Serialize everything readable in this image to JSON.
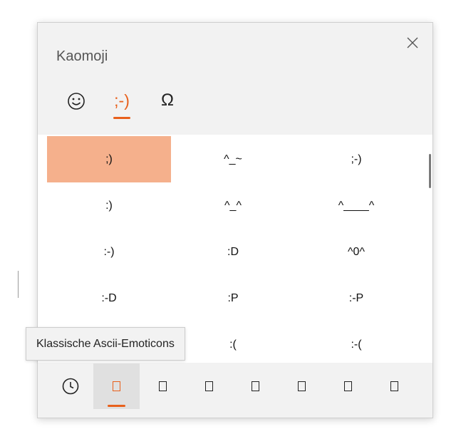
{
  "panel": {
    "title": "Kaomoji",
    "close_icon": "close-icon"
  },
  "category_tabs": [
    {
      "name": "emoji",
      "glyph": "☺",
      "icon": "smiley-icon",
      "active": false
    },
    {
      "name": "kaomoji",
      "glyph": ";-)",
      "icon": "kaomoji-icon",
      "active": true
    },
    {
      "name": "symbols",
      "glyph": "Ω",
      "icon": "omega-icon",
      "active": false
    }
  ],
  "kaomoji_grid": [
    [
      ";)",
      "^_~",
      ";-)"
    ],
    [
      ":)",
      "^_^",
      "^____^"
    ],
    [
      ":-)",
      ":D",
      "^0^"
    ],
    [
      ":-D",
      ":P",
      ":-P"
    ],
    [
      "",
      ":(",
      ":-("
    ]
  ],
  "selected_cell": [
    0,
    0
  ],
  "tooltip": {
    "text": "Klassische Ascii-Emoticons"
  },
  "sub_tabs": [
    {
      "name": "recent",
      "icon": "clock-icon",
      "active": false
    },
    {
      "name": "classic-ascii",
      "icon": "tofu-glyph-icon",
      "active": true
    },
    {
      "name": "category-3",
      "icon": "tofu-glyph-icon",
      "active": false
    },
    {
      "name": "category-4",
      "icon": "tofu-glyph-icon",
      "active": false
    },
    {
      "name": "category-5",
      "icon": "tofu-glyph-icon",
      "active": false
    },
    {
      "name": "category-6",
      "icon": "tofu-glyph-icon",
      "active": false
    },
    {
      "name": "category-7",
      "icon": "tofu-glyph-icon",
      "active": false
    },
    {
      "name": "category-8",
      "icon": "tofu-glyph-icon",
      "active": false
    }
  ],
  "colors": {
    "accent": "#e8601c",
    "selection": "#f5b08c",
    "panel_bg": "#f2f2f2"
  }
}
